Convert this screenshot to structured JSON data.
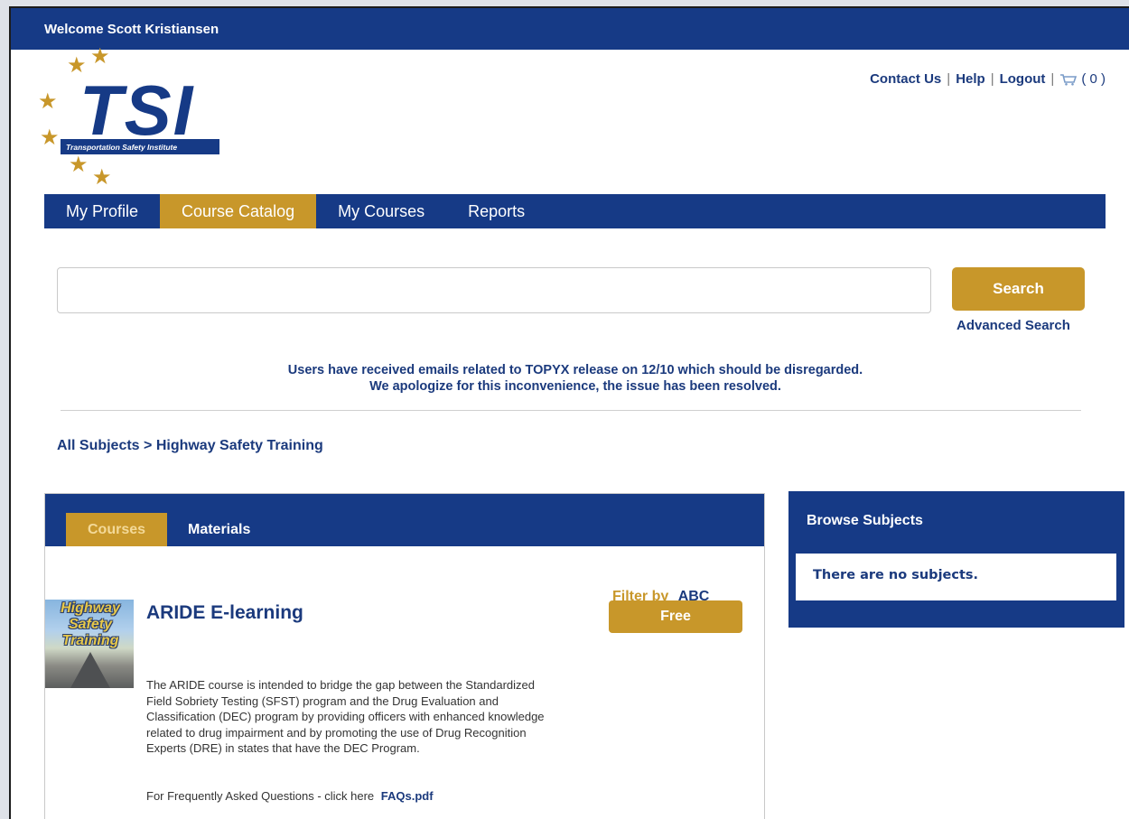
{
  "header": {
    "welcome": "Welcome Scott Kristiansen"
  },
  "logo": {
    "title": "TSI",
    "subtitle": "Transportation Safety Institute"
  },
  "top_links": {
    "contact": "Contact Us",
    "help": "Help",
    "logout": "Logout",
    "separator": "|",
    "cart_count": "( 0 )"
  },
  "nav": {
    "items": [
      {
        "label": "My Profile"
      },
      {
        "label": "Course Catalog"
      },
      {
        "label": "My Courses"
      },
      {
        "label": "Reports"
      }
    ],
    "active_index": 1
  },
  "search": {
    "value": "",
    "placeholder": "",
    "button_label": "Search",
    "advanced_label": "Advanced Search"
  },
  "notice": {
    "line1": "Users have received emails related to TOPYX release on 12/10 which should be disregarded.",
    "line2": "We apologize for this inconvenience, the issue has been resolved."
  },
  "breadcrumb": "All Subjects > Highway Safety Training",
  "main": {
    "tabs": [
      {
        "label": "Courses"
      },
      {
        "label": "Materials"
      }
    ],
    "filter_label": "Filter by",
    "filter_value": "ABC",
    "course": {
      "thumb_text": "Highway Safety Training",
      "title": "ARIDE E-learning",
      "price_button": "Free",
      "description": "The ARIDE course is intended to bridge the gap between the Standardized Field Sobriety Testing (SFST) program and the Drug Evaluation and Classification (DEC) program by providing officers with enhanced knowledge related to drug impairment and by promoting the use of Drug Recognition Experts (DRE) in states that have the DEC Program.",
      "faq_text": "For Frequently Asked Questions - click here",
      "faq_link": "FAQs.pdf"
    }
  },
  "browse": {
    "title": "Browse Subjects",
    "empty_text": "There are no subjects."
  },
  "colors": {
    "brand_blue": "#163a86",
    "accent_gold": "#c8972a"
  }
}
